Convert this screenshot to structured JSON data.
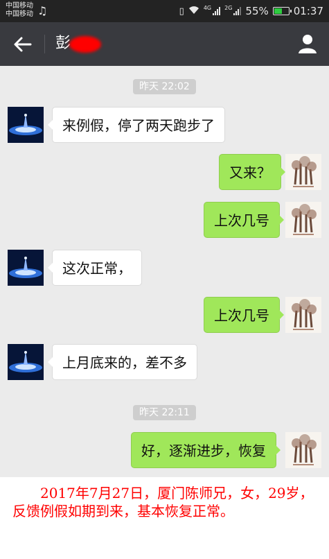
{
  "status_bar": {
    "carrier_1": "中国移动",
    "carrier_2": "中国移动",
    "network_1": "4G",
    "network_2": "2G",
    "battery": "55%",
    "time": "01:37"
  },
  "nav": {
    "title": "彭"
  },
  "chat": {
    "time_1": "昨天 22:02",
    "msg_1": "来例假，停了两天跑步了",
    "msg_2": "又来？",
    "msg_3": "上次几号",
    "msg_4": "这次正常，",
    "msg_5": "上次几号",
    "msg_6": "上月底来的，差不多",
    "time_2": "昨天 22:11",
    "msg_7": "好，逐渐进步，恢复"
  },
  "caption": {
    "text": "2017年7月27日，厦门陈师兄，女，29岁，反馈例假如期到来，基本恢复正常。"
  },
  "colors": {
    "caption_text": "#ff0000",
    "outgoing_bubble": "#a0e75a",
    "nav_bar": "#393a3f"
  }
}
